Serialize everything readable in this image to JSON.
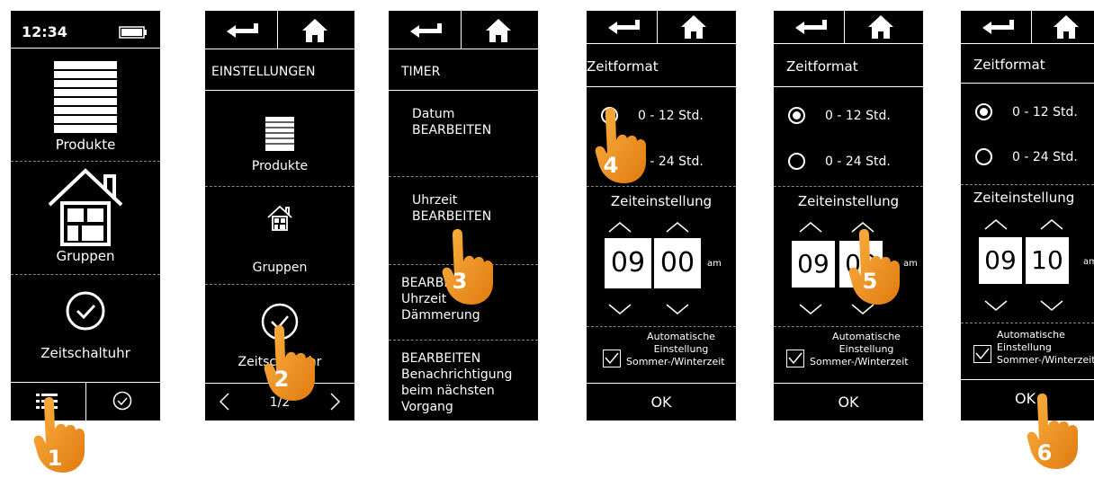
{
  "screen1": {
    "time": "12:34",
    "items": [
      "Produkte",
      "Gruppen",
      "Zeitschaltuhr"
    ]
  },
  "screen2": {
    "title": "EINSTELLUNGEN",
    "items": [
      "Produkte",
      "Gruppen",
      "Zeitschaltuhr"
    ],
    "pager": "1/2"
  },
  "screen3": {
    "title": "TIMER",
    "items": [
      {
        "line1": "Datum",
        "line2": "BEARBEITEN"
      },
      {
        "line1": "Uhrzeit",
        "line2": "BEARBEITEN"
      },
      {
        "line1": "BEARBEITEN",
        "line2": "Uhrzeit",
        "line3": "Dämmerung"
      },
      {
        "line1": "BEARBEITEN",
        "line2": "Benachrichtigung",
        "line3": "beim nächsten",
        "line4": "Vorgang"
      }
    ]
  },
  "timeFormat": {
    "title": "Zeitformat",
    "option12": "0 - 12 Std.",
    "option24": "0 - 24 Std.",
    "setting": "Zeiteinstellung",
    "ampm": "am",
    "auto1": "Automatische",
    "auto2": "Einstellung",
    "auto3": "Sommer-/Winterzeit",
    "ok": "OK",
    "hours": "09",
    "minutesA": "00",
    "minutesB": "00",
    "minutesC": "10"
  },
  "steps": [
    "1",
    "2",
    "3",
    "4",
    "5",
    "6"
  ],
  "colors": {
    "screen": "#000000",
    "hand": "#f39a1e",
    "handDark": "#d9780e"
  }
}
